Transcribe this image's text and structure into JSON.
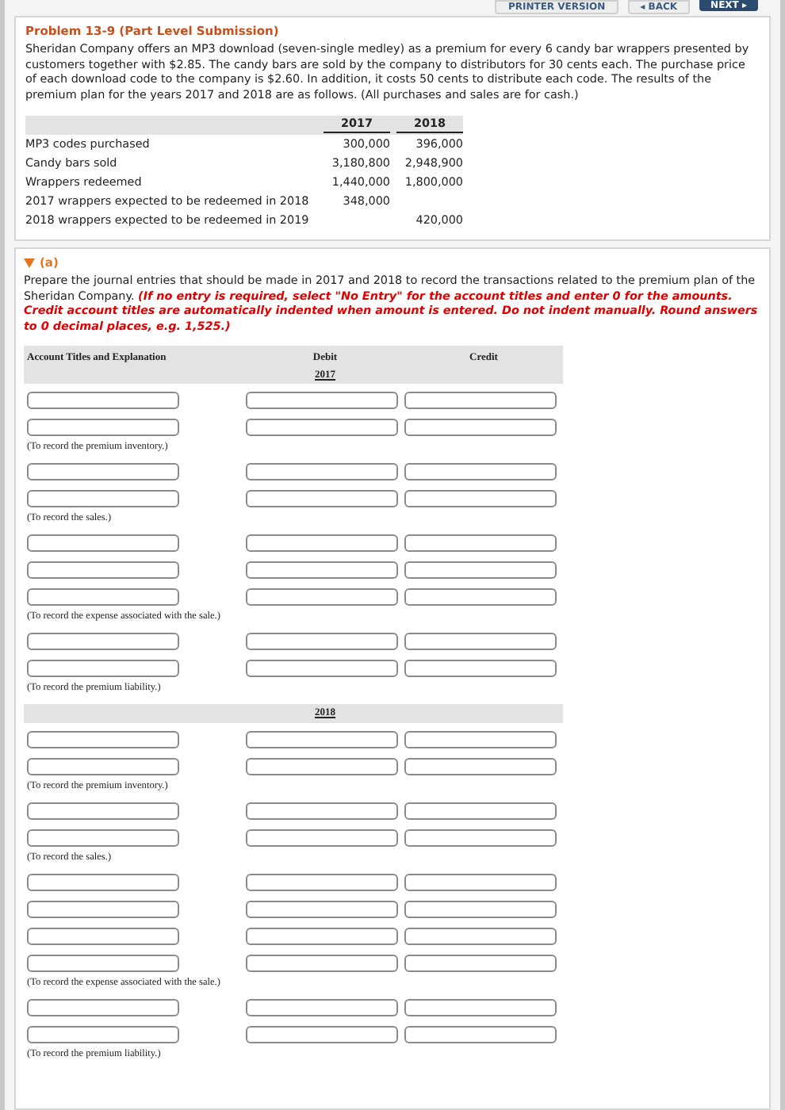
{
  "toolbar": {
    "buttons": [
      {
        "label": "PRINTER VERSION",
        "kind": "plain"
      },
      {
        "label": "◂ BACK",
        "kind": "plain"
      },
      {
        "label": "NEXT ▸",
        "kind": "primary"
      }
    ]
  },
  "problem": {
    "title": "Problem 13-9 (Part Level Submission)",
    "text": "Sheridan Company offers an MP3 download (seven-single medley) as a premium for every 6 candy bar wrappers presented by customers together with $2.85. The candy bars are sold by the company to distributors for 30 cents each. The purchase price of each download code to the company is $2.60. In addition, it costs 50 cents to distribute each code. The results of the premium plan for the years 2017 and 2018 are as follows. (All purchases and sales are for cash.)",
    "table": {
      "columns": [
        "2017",
        "2018"
      ],
      "rows": [
        {
          "label": "MP3 codes purchased",
          "values": [
            "300,000",
            "396,000"
          ]
        },
        {
          "label": "Candy bars sold",
          "values": [
            "3,180,800",
            "2,948,900"
          ]
        },
        {
          "label": "Wrappers redeemed",
          "values": [
            "1,440,000",
            "1,800,000"
          ]
        },
        {
          "label": "2017 wrappers expected to be redeemed in 2018",
          "values": [
            "348,000",
            {
              "kind": "empty"
            }
          ]
        },
        {
          "label": "2018 wrappers expected to be redeemed in 2019",
          "values": [
            {
              "kind": "empty"
            },
            "420,000"
          ]
        }
      ]
    }
  },
  "part": {
    "label": "(a)",
    "expanded": true,
    "instruction": "Prepare the journal entries that should be made in 2017 and 2018 to record the transactions related to the premium plan of the Sheridan Company.",
    "note": "(If no entry is required, select \"No Entry\" for the account titles and enter 0 for the amounts. Credit account titles are automatically indented when amount is entered. Do not indent manually. Round answers to 0 decimal places, e.g. 1,525.)",
    "journal": {
      "columns": [
        "Account Titles and Explanation",
        "Debit",
        "Credit"
      ],
      "years": [
        {
          "year": "2017",
          "entries": [
            {
              "lines": [
                {
                  "kind": "input-row"
                },
                {
                  "kind": "input-row"
                }
              ],
              "explanation": "(To record the premium inventory.)"
            },
            {
              "lines": [
                {
                  "kind": "input-row"
                },
                {
                  "kind": "input-row"
                }
              ],
              "explanation": "(To record the sales.)"
            },
            {
              "lines": [
                {
                  "kind": "input-row"
                },
                {
                  "kind": "input-row"
                },
                {
                  "kind": "input-row"
                }
              ],
              "explanation": "(To record the expense associated with the sale.)"
            },
            {
              "lines": [
                {
                  "kind": "input-row"
                },
                {
                  "kind": "input-row"
                }
              ],
              "explanation": "(To record the premium liability.)"
            }
          ]
        },
        {
          "year": "2018",
          "entries": [
            {
              "lines": [
                {
                  "kind": "input-row"
                },
                {
                  "kind": "input-row"
                }
              ],
              "explanation": "(To record the premium inventory.)"
            },
            {
              "lines": [
                {
                  "kind": "input-row"
                },
                {
                  "kind": "input-row"
                }
              ],
              "explanation": "(To record the sales.)"
            },
            {
              "lines": [
                {
                  "kind": "input-row"
                },
                {
                  "kind": "input-row"
                },
                {
                  "kind": "input-row"
                },
                {
                  "kind": "input-row"
                }
              ],
              "explanation": "(To record the expense associated with the sale.)"
            },
            {
              "lines": [
                {
                  "kind": "input-row"
                },
                {
                  "kind": "input-row"
                }
              ],
              "explanation": "(To record the premium liability.)"
            }
          ]
        }
      ]
    }
  }
}
